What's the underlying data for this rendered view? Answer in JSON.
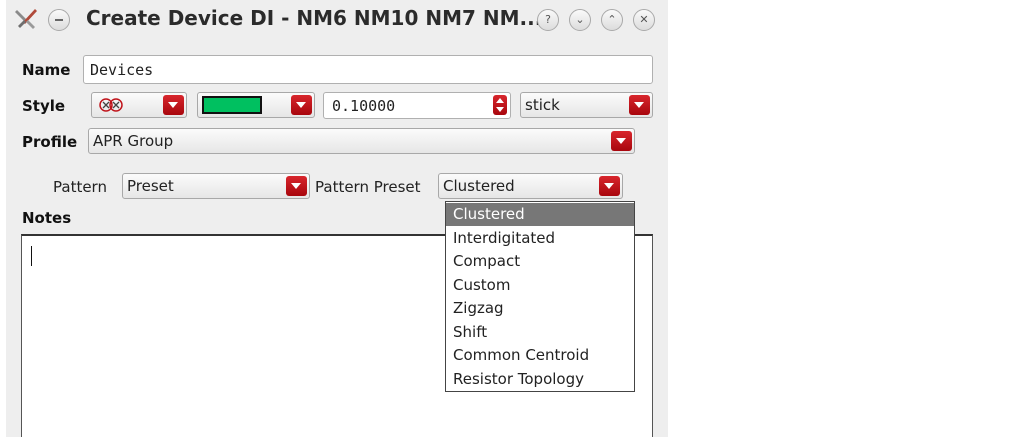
{
  "window": {
    "title": "Create Device DI - NM6 NM10 NM7 NM..."
  },
  "titlebar_icons": [
    "tools-icon",
    "window-menu-icon",
    "help-icon",
    "minimize-icon",
    "maximize-icon",
    "close-icon"
  ],
  "form": {
    "name_label": "Name",
    "name_value": "Devices",
    "style_label": "Style",
    "style_color": "#00c060",
    "width_value": "0.10000",
    "line_style": "stick",
    "profile_label": "Profile",
    "profile_value": "APR Group",
    "pattern_label": "Pattern",
    "pattern_value": "Preset",
    "pattern_preset_label": "Pattern Preset",
    "pattern_preset_value": "Clustered",
    "notes_label": "Notes",
    "notes_value": ""
  },
  "pattern_preset_options": [
    {
      "label": "Clustered",
      "selected": true
    },
    {
      "label": "Interdigitated",
      "selected": false
    },
    {
      "label": "Compact",
      "selected": false
    },
    {
      "label": "Custom",
      "selected": false
    },
    {
      "label": "Zigzag",
      "selected": false
    },
    {
      "label": "Shift",
      "selected": false
    },
    {
      "label": "Common Centroid",
      "selected": false
    },
    {
      "label": "Resistor Topology",
      "selected": false
    }
  ],
  "colors": {
    "accent": "#c0141b",
    "selected_bg": "#777777"
  }
}
